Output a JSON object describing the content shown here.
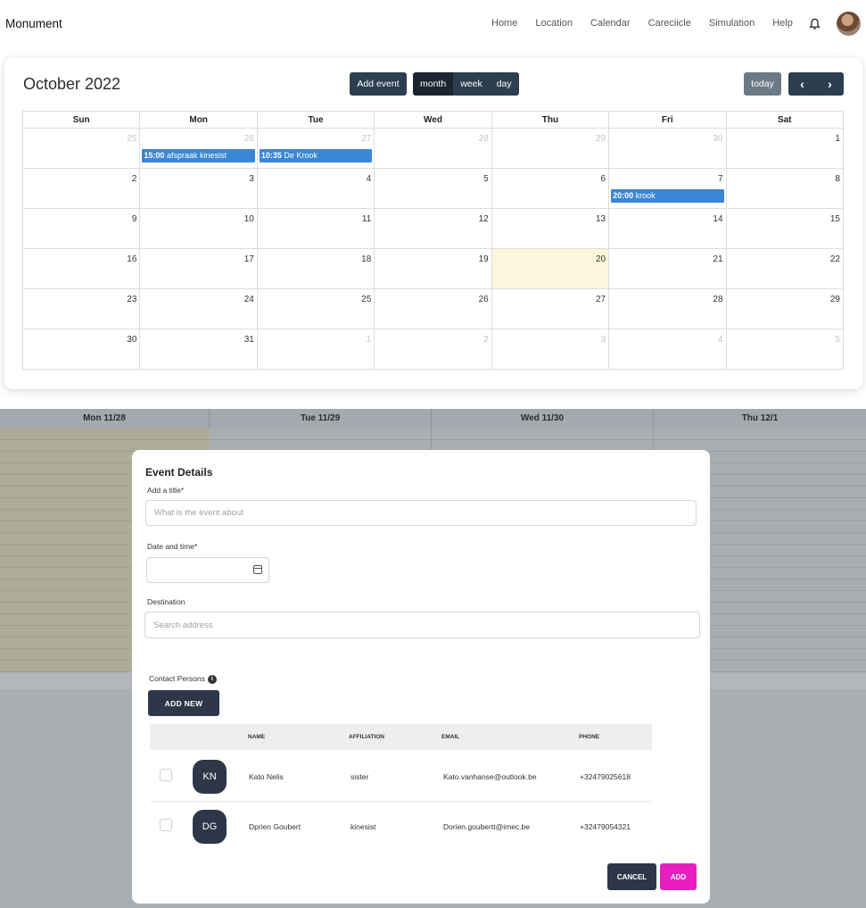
{
  "app": {
    "brand": "Monument"
  },
  "nav": {
    "items": [
      "Home",
      "Location",
      "Calendar",
      "Careciicle",
      "Simulation",
      "Help"
    ],
    "bell_icon": "bell-icon",
    "avatar_icon": "user-avatar"
  },
  "calendar": {
    "title": "October 2022",
    "add_event_label": "Add event",
    "views": [
      "month",
      "week",
      "day"
    ],
    "active_view": "month",
    "today_label": "today",
    "prev_icon": "chevron-left-icon",
    "next_icon": "chevron-right-icon",
    "weekdays": [
      "Sun",
      "Mon",
      "Tue",
      "Wed",
      "Thu",
      "Fri",
      "Sat"
    ],
    "weeks": [
      [
        {
          "n": "25",
          "other": true
        },
        {
          "n": "26",
          "other": true,
          "event_time": "15:00",
          "event_title": "afspraak kinesist"
        },
        {
          "n": "27",
          "other": true,
          "event_time": "10:35",
          "event_title": "De Krook"
        },
        {
          "n": "28",
          "other": true
        },
        {
          "n": "29",
          "other": true
        },
        {
          "n": "30",
          "other": true
        },
        {
          "n": "1"
        }
      ],
      [
        {
          "n": "2"
        },
        {
          "n": "3"
        },
        {
          "n": "4"
        },
        {
          "n": "5"
        },
        {
          "n": "6"
        },
        {
          "n": "7",
          "event_time": "20:00",
          "event_title": "krook"
        },
        {
          "n": "8"
        }
      ],
      [
        {
          "n": "9"
        },
        {
          "n": "10"
        },
        {
          "n": "11"
        },
        {
          "n": "12"
        },
        {
          "n": "13"
        },
        {
          "n": "14"
        },
        {
          "n": "15"
        }
      ],
      [
        {
          "n": "16"
        },
        {
          "n": "17"
        },
        {
          "n": "18"
        },
        {
          "n": "19"
        },
        {
          "n": "20",
          "today": true
        },
        {
          "n": "21"
        },
        {
          "n": "22"
        }
      ],
      [
        {
          "n": "23"
        },
        {
          "n": "24"
        },
        {
          "n": "25"
        },
        {
          "n": "26"
        },
        {
          "n": "27"
        },
        {
          "n": "28"
        },
        {
          "n": "29"
        }
      ],
      [
        {
          "n": "30"
        },
        {
          "n": "31"
        },
        {
          "n": "1",
          "other": true
        },
        {
          "n": "2",
          "other": true
        },
        {
          "n": "3",
          "other": true
        },
        {
          "n": "4",
          "other": true
        },
        {
          "n": "5",
          "other": true
        }
      ]
    ]
  },
  "week_view": {
    "headers": [
      "Mon 11/28",
      "Tue 11/29",
      "Wed 11/30",
      "Thu 12/1"
    ]
  },
  "modal": {
    "title": "Event Details",
    "title_label": "Add a title*",
    "title_placeholder": "What is the event about",
    "date_label": "Date and time*",
    "date_value": "",
    "destination_label": "Destination",
    "destination_placeholder": "Search address",
    "contacts_label": "Contact Persons",
    "add_new_label": "ADD NEW",
    "columns": {
      "name": "NAME",
      "affiliation": "AFFILIATION",
      "email": "EMAIL",
      "phone": "PHONE"
    },
    "contacts": [
      {
        "initials": "KN",
        "name": "Kato Nelis",
        "affiliation": "sister",
        "email": "Kato.vanhanse@outlook.be",
        "phone": "+32479025618"
      },
      {
        "initials": "DG",
        "name": "Dprien Goubert",
        "affiliation": "kinesist",
        "email": "Dorien.goubertt@imec.be",
        "phone": "+32479054321"
      }
    ],
    "cancel_label": "CANCEL",
    "add_label": "ADD"
  },
  "colors": {
    "dark": "#2c3e50",
    "event_blue": "#3a87d6",
    "today_bg": "#fcf7dc",
    "accent_pink": "#e91ec0"
  }
}
